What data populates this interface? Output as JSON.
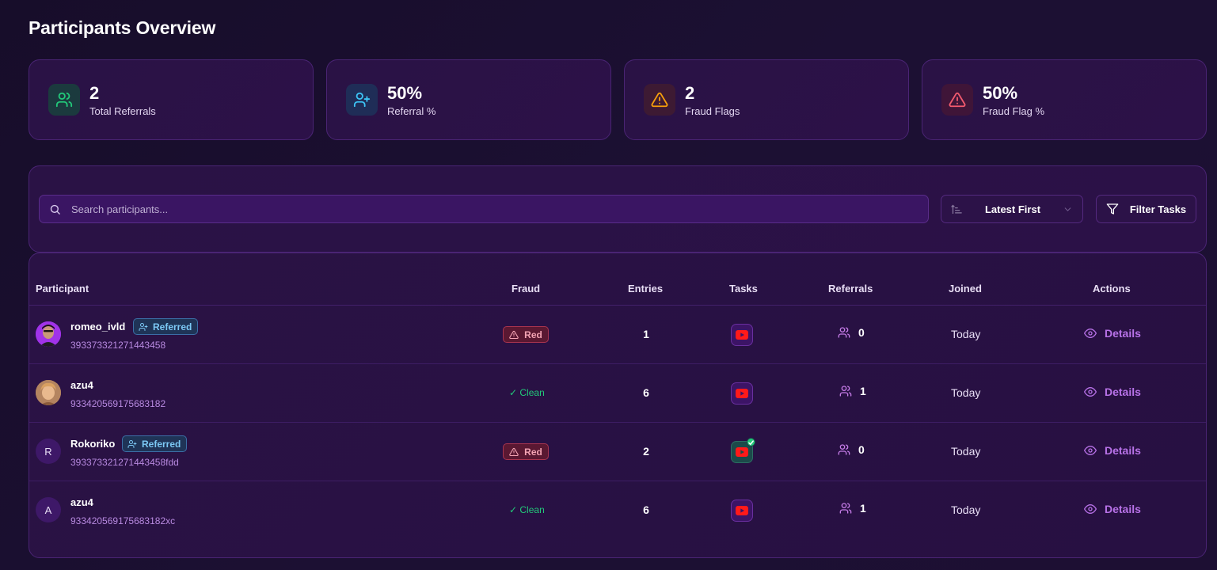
{
  "page": {
    "title": "Participants Overview"
  },
  "stats": [
    {
      "value": "2",
      "label": "Total Referrals",
      "icon": "users-icon",
      "color": "#22c97a",
      "bg": "#1b3a3e"
    },
    {
      "value": "50%",
      "label": "Referral %",
      "icon": "user-plus-icon",
      "color": "#3cc4f5",
      "bg": "#1f2d57"
    },
    {
      "value": "2",
      "label": "Fraud Flags",
      "icon": "warning-icon",
      "color": "#f59e0b",
      "bg": "#3d1a33"
    },
    {
      "value": "50%",
      "label": "Fraud Flag %",
      "icon": "alert-triangle-icon",
      "color": "#f25a6e",
      "bg": "#3f1538"
    }
  ],
  "toolbar": {
    "search_placeholder": "Search participants...",
    "sort_label": "Latest First",
    "filter_label": "Filter Tasks"
  },
  "table": {
    "headers": {
      "participant": "Participant",
      "fraud": "Fraud",
      "entries": "Entries",
      "tasks": "Tasks",
      "referrals": "Referrals",
      "joined": "Joined",
      "actions": "Actions"
    },
    "referred_label": "Referred",
    "details_label": "Details",
    "rows": [
      {
        "name": "romeo_ivld",
        "id": "393373321271443458",
        "referred": true,
        "avatar_letter": "",
        "fraud": "Red",
        "entries": "1",
        "task_done": false,
        "referrals": "0",
        "joined": "Today"
      },
      {
        "name": "azu4",
        "id": "933420569175683182",
        "referred": false,
        "avatar_letter": "",
        "fraud": "✓ Clean",
        "entries": "6",
        "task_done": false,
        "referrals": "1",
        "joined": "Today"
      },
      {
        "name": "Rokoriko",
        "id": "393373321271443458fdd",
        "referred": true,
        "avatar_letter": "R",
        "fraud": "Red",
        "entries": "2",
        "task_done": true,
        "referrals": "0",
        "joined": "Today"
      },
      {
        "name": "azu4",
        "id": "933420569175683182xc",
        "referred": false,
        "avatar_letter": "A",
        "fraud": "✓ Clean",
        "entries": "6",
        "task_done": false,
        "referrals": "1",
        "joined": "Today"
      }
    ]
  }
}
